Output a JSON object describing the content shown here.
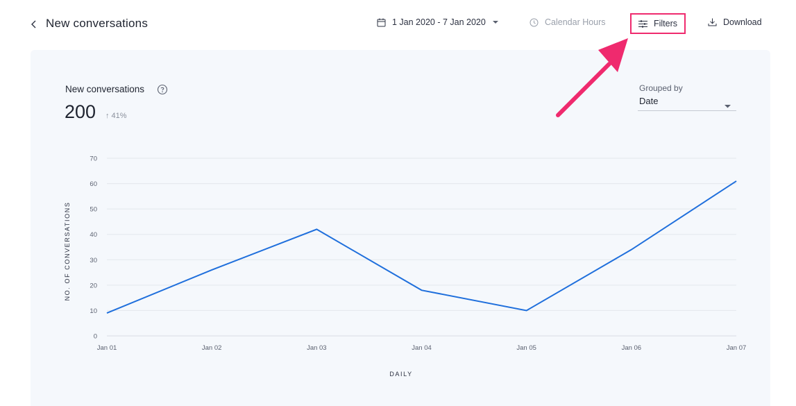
{
  "header": {
    "back_label": "<",
    "title": "New conversations",
    "date_range": "1 Jan 2020 - 7 Jan 2020",
    "calendar_hours": "Calendar Hours",
    "filters": "Filters",
    "download": "Download"
  },
  "icons": {
    "back": "chevron-left-icon",
    "date": "calendar-icon",
    "date_caret": "caret-down-icon",
    "calendar_hours": "clock-icon",
    "filters": "sliders-icon",
    "download": "download-icon",
    "help": "question-circle-icon",
    "change": "arrow-up-icon",
    "select_caret": "caret-down-icon"
  },
  "metric": {
    "title": "New conversations",
    "value": "200",
    "change": "↑ 41%"
  },
  "grouped_by": {
    "label": "Grouped by",
    "value": "Date"
  },
  "colors": {
    "accent_line": "#1f6fdc",
    "highlight": "#ef2a6e",
    "panel_bg": "#f5f8fc"
  },
  "chart_data": {
    "type": "line",
    "categories": [
      "Jan 01",
      "Jan 02",
      "Jan 03",
      "Jan 04",
      "Jan 05",
      "Jan 06",
      "Jan 07"
    ],
    "series": [
      {
        "values": [
          9,
          26,
          42,
          18,
          10,
          34,
          61
        ]
      }
    ],
    "xlabel": "DAILY",
    "ylabel": "NO. OF CONVERSATIONS",
    "ylim": [
      0,
      70
    ],
    "yticks": [
      0,
      10,
      20,
      30,
      40,
      50,
      60,
      70
    ],
    "grid": true,
    "legend": "none"
  }
}
